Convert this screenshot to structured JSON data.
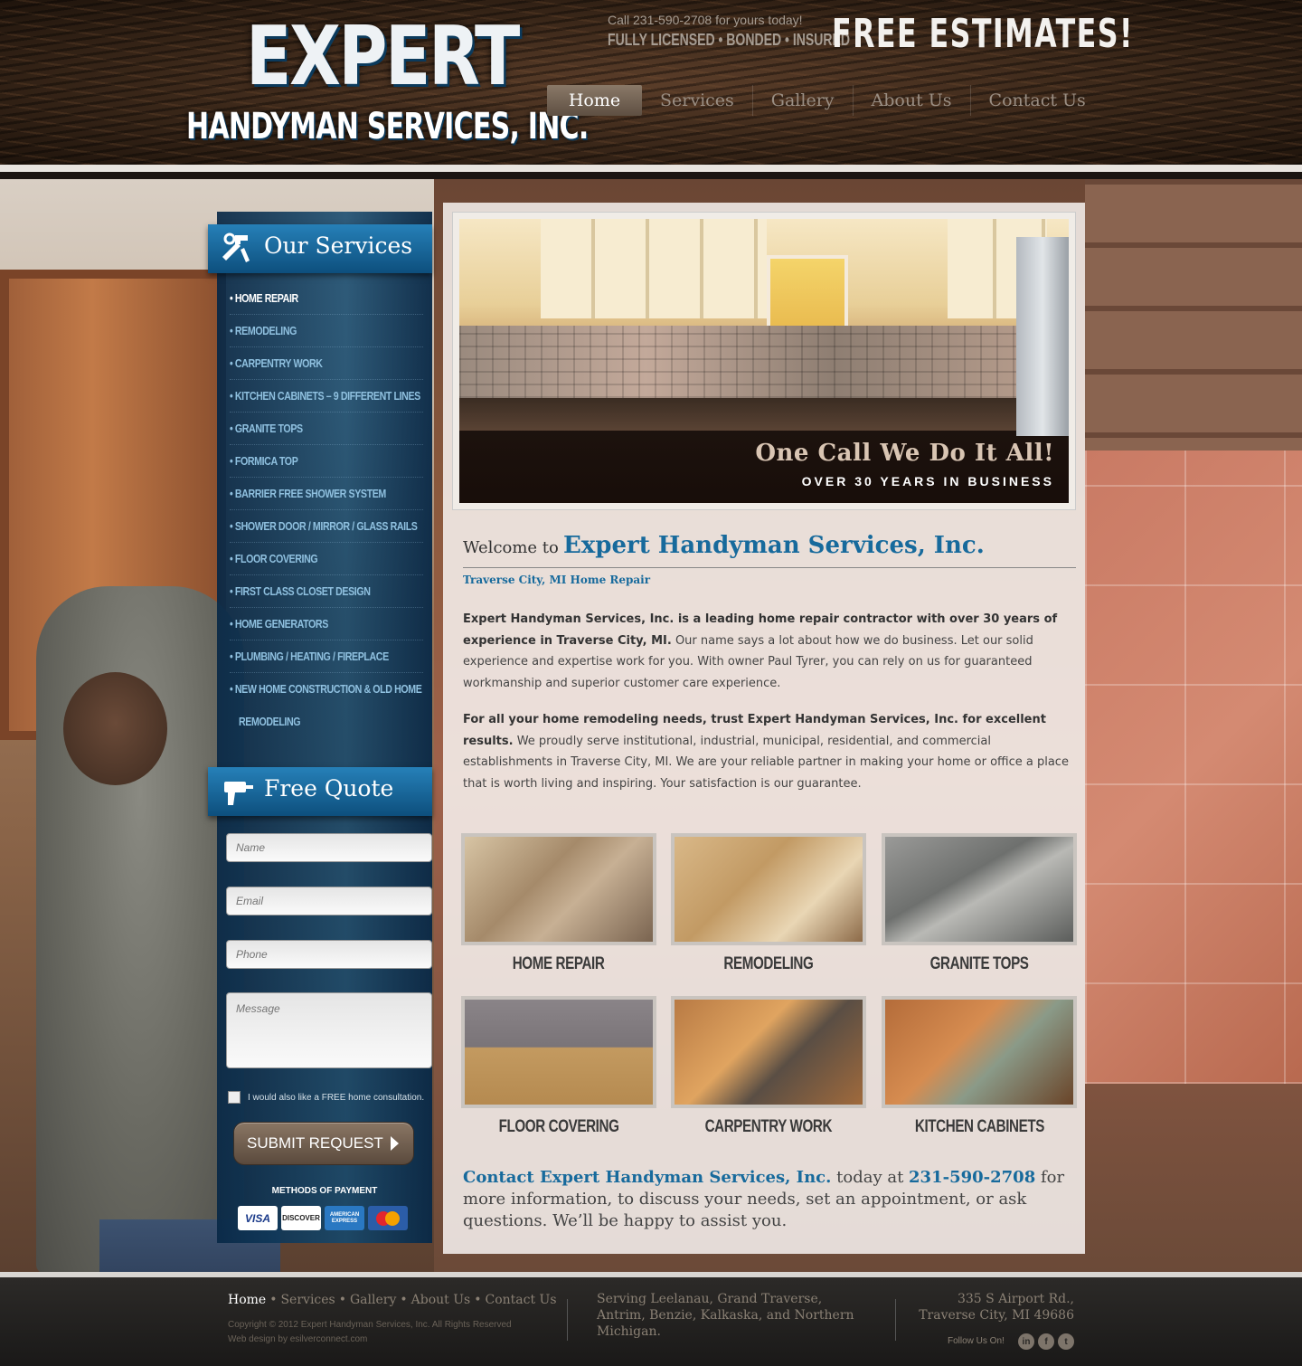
{
  "header": {
    "logo_main": "EXPERT",
    "logo_sub": "HANDYMAN SERVICES, INC.",
    "call_line": "Call 231-590-2708 for yours today!",
    "licensed_line": "FULLY LICENSED • BONDED • INSURED",
    "free_estimates": "FREE ESTIMATES!"
  },
  "nav": {
    "items": [
      {
        "label": "Home",
        "active": true
      },
      {
        "label": "Services",
        "active": false
      },
      {
        "label": "Gallery",
        "active": false
      },
      {
        "label": "About Us",
        "active": false
      },
      {
        "label": "Contact Us",
        "active": false
      }
    ]
  },
  "sidebar": {
    "services_title": "Our Services",
    "services": [
      "• HOME REPAIR",
      "• REMODELING",
      "• CARPENTRY WORK",
      "• KITCHEN CABINETS – 9 DIFFERENT LINES",
      "• GRANITE TOPS",
      "• FORMICA TOP",
      "• BARRIER FREE SHOWER SYSTEM",
      "• SHOWER DOOR / MIRROR / GLASS RAILS",
      "• FLOOR COVERING",
      "• FIRST CLASS CLOSET DESIGN",
      "• HOME GENERATORS",
      "• PLUMBING / HEATING / FIREPLACE",
      "• NEW HOME CONSTRUCTION & OLD HOME",
      "REMODELING"
    ],
    "quote_title": "Free Quote",
    "form": {
      "name_placeholder": "Name",
      "email_placeholder": "Email",
      "phone_placeholder": "Phone",
      "message_placeholder": "Message",
      "consult_label": "I would also like a FREE home consultation.",
      "submit_label": "SUBMIT REQUEST"
    },
    "payment_title": "METHODS OF PAYMENT",
    "cards": {
      "visa": "VISA",
      "discover": "DISCOVER",
      "amex": "AMERICAN EXPRESS",
      "mastercard": "MasterCard"
    }
  },
  "banner": {
    "title": "One Call We Do It All!",
    "subtitle": "OVER 30 YEARS IN BUSINESS"
  },
  "main": {
    "welcome_pre": "Welcome to",
    "welcome_name": "Expert Handyman Services, Inc.",
    "tagline": "Traverse City, MI Home Repair",
    "para1_bold": "Expert Handyman Services, Inc. is a leading home repair contractor with over 30 years of experience in Traverse City, MI.",
    "para1_rest": " Our name says a lot about how we do business. Let our solid experience and expertise work for you. With owner Paul Tyrer, you can rely on us for guaranteed workmanship and superior customer care experience.",
    "para2_bold": "For all your home remodeling needs, trust Expert Handyman Services, Inc. for excellent results.",
    "para2_rest": " We proudly serve institutional, industrial, municipal, residential, and commercial establishments in Traverse City, MI. We are your reliable partner in making your home or office a place that is worth living and inspiring. Your satisfaction is our guarantee.",
    "tiles": [
      "HOME REPAIR",
      "REMODELING",
      "GRANITE TOPS",
      "FLOOR COVERING",
      "CARPENTRY WORK",
      "KITCHEN CABINETS"
    ],
    "contact_name": "Contact Expert Handyman Services, Inc.",
    "contact_mid": " today at ",
    "contact_phone": "231-590-2708",
    "contact_rest": " for more information, to discuss your needs, set an appointment, or ask questions. We’ll be happy to assist you."
  },
  "footer": {
    "nav": [
      "Home",
      "Services",
      "Gallery",
      "About Us",
      "Contact Us"
    ],
    "copyright": "Copyright © 2012 Expert Handyman Services, Inc. All Rights Reserved",
    "design_credit": "Web design by esilverconnect.com",
    "serving": "Serving Leelanau, Grand Traverse, Antrim, Benzie, Kalkaska, and Northern Michigan.",
    "address_line1": "335 S Airport Rd.,",
    "address_line2": "Traverse City, MI 49686",
    "follow": "Follow Us On!",
    "social": [
      "in",
      "f",
      "t"
    ]
  },
  "colors": {
    "accent_blue": "#176a9c",
    "sidebar_blue": "#0d4f7d",
    "header_brown": "#3a2719"
  }
}
